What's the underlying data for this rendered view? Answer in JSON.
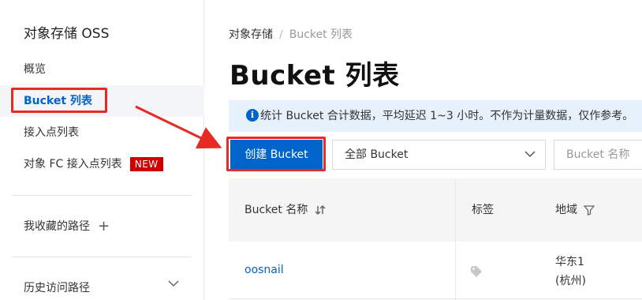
{
  "sidebar": {
    "title": "对象存储 OSS",
    "items": [
      {
        "label": "概览"
      },
      {
        "label": "Bucket 列表"
      },
      {
        "label": "接入点列表"
      },
      {
        "label": "对象 FC 接入点列表",
        "badge": "NEW"
      }
    ],
    "favorites_label": "我收藏的路径",
    "history_label": "历史访问路径"
  },
  "breadcrumb": {
    "root": "对象存储",
    "separator": "/",
    "current": "Bucket 列表"
  },
  "page_title": "Bucket 列表",
  "notice": "统计 Bucket 合计数据，平均延迟 1~3 小时。不作为计量数据，仅作参考。",
  "toolbar": {
    "create_label": "创建 Bucket",
    "filter_value": "全部 Bucket",
    "search_placeholder": "Bucket 名称"
  },
  "table": {
    "columns": [
      "Bucket 名称",
      "标签",
      "地域"
    ],
    "rows": [
      {
        "name": "oosnail",
        "region_line1": "华东1",
        "region_line2": "(杭州)"
      }
    ]
  },
  "colors": {
    "accent": "#0064c8",
    "annotation": "#e62a24",
    "badge": "#d10000",
    "notice_bg": "#e6f1fb"
  }
}
